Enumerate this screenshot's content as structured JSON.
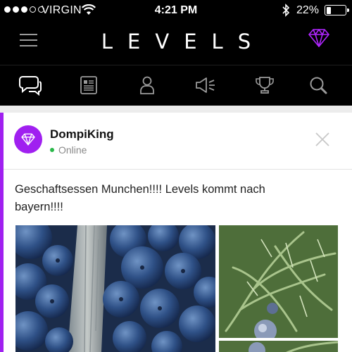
{
  "status_bar": {
    "carrier": "VIRGIN",
    "time": "4:21 PM",
    "battery_percent": "22%",
    "battery_level": 0.22,
    "signal_bars": 3,
    "signal_total": 5
  },
  "header": {
    "logo": "LEVELS",
    "accent_color": "#a020f0"
  },
  "nav": {
    "tabs": [
      {
        "icon": "chat-bubbles-icon",
        "active": true
      },
      {
        "icon": "newspaper-icon",
        "active": false
      },
      {
        "icon": "profile-icon",
        "active": false
      },
      {
        "icon": "megaphone-icon",
        "active": false
      },
      {
        "icon": "trophy-icon",
        "active": false
      },
      {
        "icon": "search-icon",
        "active": false
      }
    ]
  },
  "post": {
    "username": "DompiKing",
    "status": "Online",
    "text": "Geschaftsessen Munchen!!!! Levels kommt nach bayern!!!!",
    "images": [
      "blueberries-photo",
      "juniper-branch-photo",
      "juniper-branch-photo-2"
    ]
  }
}
